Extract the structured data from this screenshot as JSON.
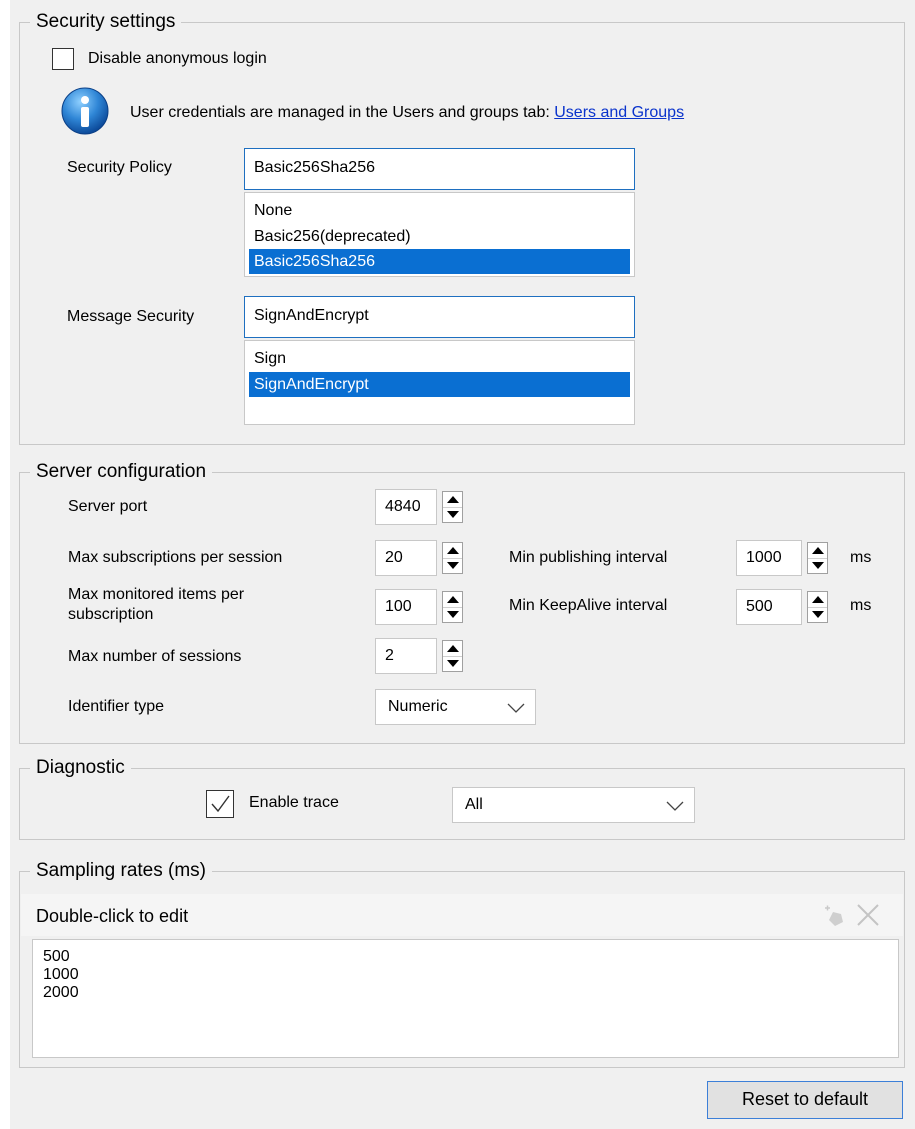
{
  "security": {
    "legend": "Security settings",
    "disable_anonymous_label": "Disable anonymous login",
    "disable_anonymous_checked": false,
    "info_text": "User credentials are managed in the Users and groups tab: ",
    "info_link": "Users and Groups",
    "policy_label": "Security Policy",
    "policy_value": "Basic256Sha256",
    "policy_options": [
      "None",
      "Basic256(deprecated)",
      "Basic256Sha256"
    ],
    "message_label": "Message Security",
    "message_value": "SignAndEncrypt",
    "message_options": [
      "Sign",
      "SignAndEncrypt"
    ]
  },
  "server": {
    "legend": "Server configuration",
    "port_label": "Server port",
    "port_value": "4840",
    "max_subs_label": "Max subscriptions per session",
    "max_subs_value": "20",
    "max_items_label": "Max monitored items per subscription",
    "max_items_value": "100",
    "max_sessions_label": "Max number of sessions",
    "max_sessions_value": "2",
    "min_pub_label": "Min publishing interval",
    "min_pub_value": "1000",
    "min_keepalive_label": "Min KeepAlive interval",
    "min_keepalive_value": "500",
    "unit_ms": "ms",
    "identifier_label": "Identifier type",
    "identifier_value": "Numeric"
  },
  "diagnostic": {
    "legend": "Diagnostic",
    "enable_trace_label": "Enable trace",
    "enable_trace_checked": true,
    "trace_level": "All"
  },
  "sampling": {
    "legend": "Sampling rates (ms)",
    "header": "Double-click to edit",
    "rates": [
      "500",
      "1000",
      "2000"
    ]
  },
  "reset_label": "Reset to default"
}
